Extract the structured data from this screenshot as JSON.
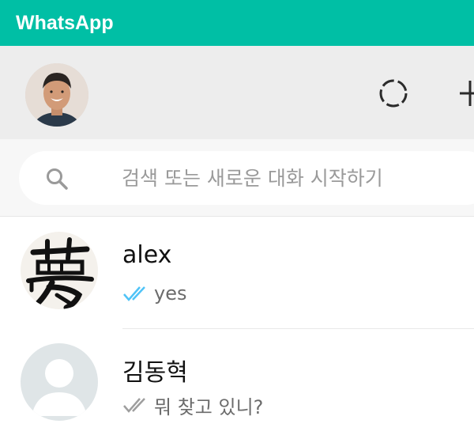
{
  "app": {
    "title": "WhatsApp"
  },
  "header": {
    "profile_avatar": "profile-photo",
    "icons": [
      "status-icon",
      "new-chat-icon"
    ]
  },
  "search": {
    "placeholder": "검색 또는 새로운 대화 시작하기",
    "icon": "search-icon"
  },
  "chats": [
    {
      "name": "alex",
      "last_message": "yes",
      "tick_color": "#4fc3f7",
      "avatar": "calligraphy-character-avatar"
    },
    {
      "name": "김동혁",
      "last_message": "뭐 찾고 있니?",
      "tick_color": "#9e9e9e",
      "avatar": "default-user-avatar"
    }
  ],
  "colors": {
    "brand": "#00bfa5",
    "header_bg": "#ededed",
    "read_tick": "#4fc3f7",
    "sent_tick": "#9e9e9e"
  }
}
